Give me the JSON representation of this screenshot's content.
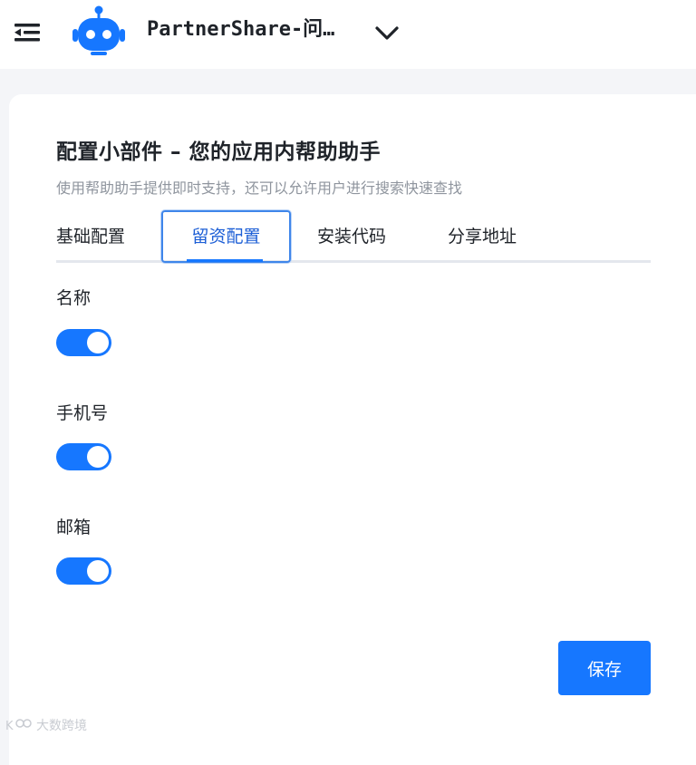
{
  "header": {
    "app_title": "PartnerShare-问…",
    "accent_color": "#1677ff",
    "icons": [
      "menu-collapse-icon",
      "robot-logo-icon",
      "chevron-down-icon"
    ]
  },
  "page": {
    "title": "配置小部件 – 您的应用内帮助助手",
    "subtitle": "使用帮助助手提供即时支持，还可以允许用户进行搜索快速查找"
  },
  "tabs": [
    {
      "label": "基础配置",
      "active": false
    },
    {
      "label": "留资配置",
      "active": true
    },
    {
      "label": "安装代码",
      "active": false
    },
    {
      "label": "分享地址",
      "active": false
    }
  ],
  "fields": [
    {
      "label": "名称",
      "enabled": true
    },
    {
      "label": "手机号",
      "enabled": true
    },
    {
      "label": "邮箱",
      "enabled": true
    }
  ],
  "actions": {
    "save_label": "保存"
  },
  "watermark": {
    "text": "大数跨境"
  }
}
